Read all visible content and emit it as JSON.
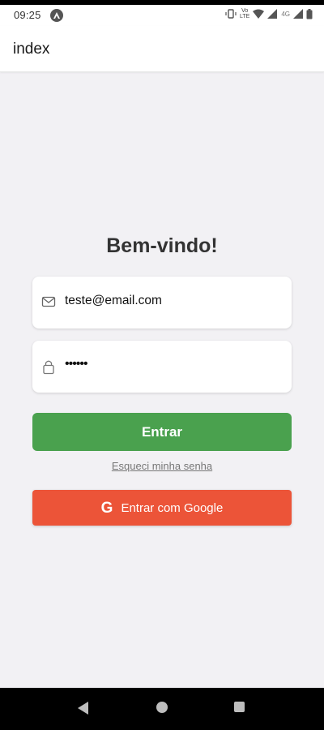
{
  "status_bar": {
    "time": "09:25",
    "volte_line1": "Vo",
    "volte_line2": "LTE",
    "network": "4G"
  },
  "app_bar": {
    "title": "index"
  },
  "login": {
    "heading": "Bem-vindo!",
    "email_value": "teste@email.com",
    "password_masked": "••••••",
    "submit_label": "Entrar",
    "forgot_link": "Esqueci minha senha",
    "google_icon_glyph": "G",
    "google_label": "Entrar com Google"
  },
  "colors": {
    "background": "#f2f1f4",
    "primary_button": "#4aa14e",
    "google_button": "#ec5438"
  },
  "icons": {
    "email": "mail-icon",
    "password": "lock-icon",
    "google": "google-icon"
  }
}
